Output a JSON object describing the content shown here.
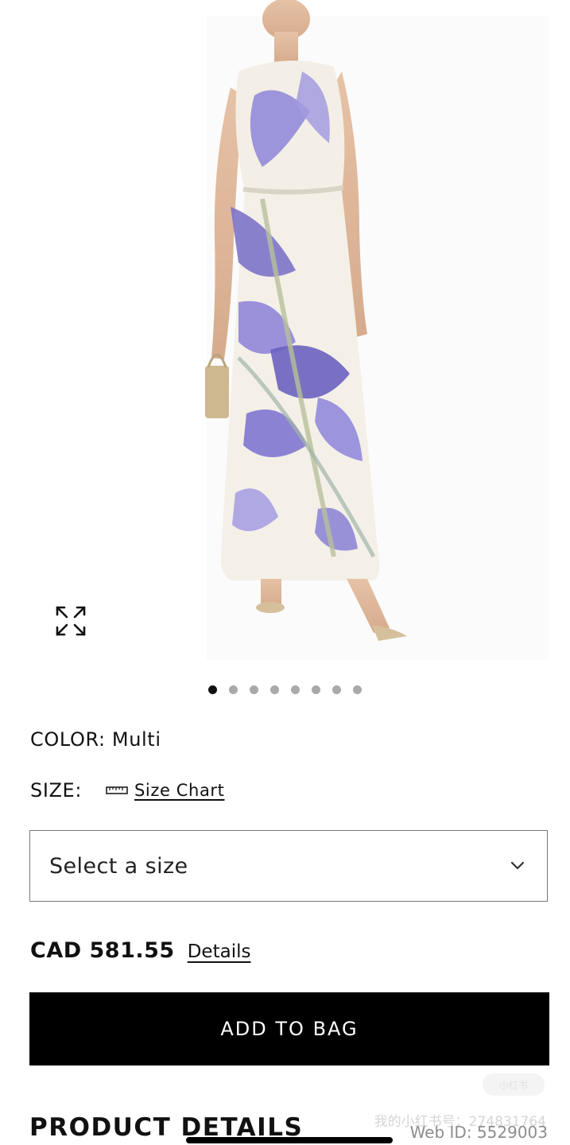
{
  "product_image": {
    "alt": "Floral maxi dress",
    "gallery_count": 8,
    "active_index": 0
  },
  "color": {
    "label": "COLOR:",
    "value": "Multi"
  },
  "size": {
    "label": "SIZE:",
    "size_chart_label": "Size Chart",
    "select_placeholder": "Select a size"
  },
  "price": {
    "amount": "CAD 581.55",
    "details_label": "Details"
  },
  "add_to_bag_label": "ADD TO BAG",
  "product_details_title": "PRODUCT DETAILS",
  "footer": {
    "web_id": "Web ID: 5529003",
    "watermark_text": "我的小红书号：274831764",
    "watermark_badge": "小红书"
  },
  "icons": {
    "expand": "expand-icon",
    "ruler": "ruler-icon",
    "chevron": "chevron-down-icon"
  },
  "colors": {
    "button_bg": "#000000",
    "dot_active": "#111111",
    "dot_inactive": "#a9a9a9",
    "dress_purple": "#7d73c9"
  }
}
